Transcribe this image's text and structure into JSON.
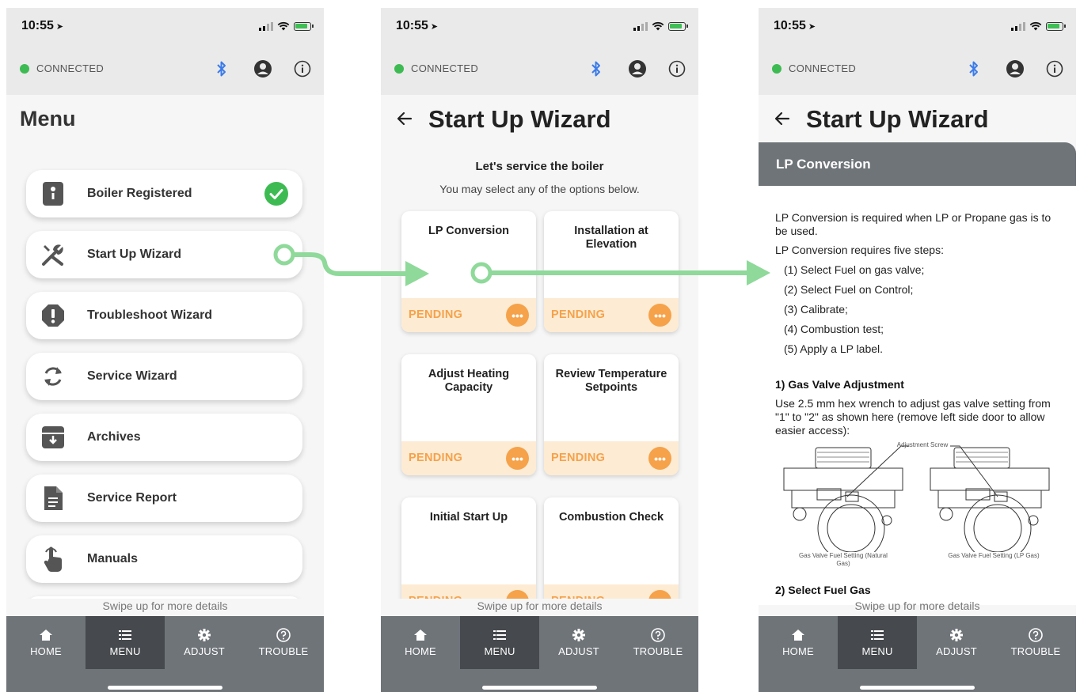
{
  "status_bar": {
    "time": "10:55"
  },
  "header": {
    "connection_label": "CONNECTED"
  },
  "tabs": [
    {
      "label": "HOME",
      "icon": "home-icon"
    },
    {
      "label": "MENU",
      "icon": "menu-list-icon",
      "active": true
    },
    {
      "label": "ADJUST",
      "icon": "gear-icon"
    },
    {
      "label": "TROUBLE",
      "icon": "question-icon"
    }
  ],
  "swipe_hint": "Swipe up for more details",
  "menu_screen": {
    "title": "Menu",
    "items": [
      {
        "label": "Boiler Registered",
        "icon": "boiler-icon",
        "status": "check-icon"
      },
      {
        "label": "Start Up Wizard",
        "icon": "tools-icon"
      },
      {
        "label": "Troubleshoot Wizard",
        "icon": "alert-octagon-icon"
      },
      {
        "label": "Service Wizard",
        "icon": "sync-icon"
      },
      {
        "label": "Archives",
        "icon": "archive-icon"
      },
      {
        "label": "Service Report",
        "icon": "document-icon"
      },
      {
        "label": "Manuals",
        "icon": "touch-hand-icon"
      }
    ]
  },
  "wizard_screen": {
    "title": "Start Up Wizard",
    "subtitle": "Let's service the boiler",
    "instruction": "You may select any of the options below.",
    "cards": [
      {
        "title": "LP Conversion",
        "status": "PENDING"
      },
      {
        "title": "Installation at Elevation",
        "status": "PENDING"
      },
      {
        "title": "Adjust Heating Capacity",
        "status": "PENDING"
      },
      {
        "title": "Review Temperature Setpoints",
        "status": "PENDING"
      },
      {
        "title": "Initial Start Up",
        "status": "PENDING"
      },
      {
        "title": "Combustion Check",
        "status": "PENDING"
      }
    ]
  },
  "lp_screen": {
    "title": "Start Up Wizard",
    "section_title": "LP Conversion",
    "intro": "LP Conversion is required when LP or Propane gas is to be used.",
    "steps_intro": "LP Conversion requires five steps:",
    "steps": [
      "(1) Select Fuel on gas valve;",
      "(2) Select Fuel on Control;",
      "(3) Calibrate;",
      "(4) Combustion test;",
      "(5) Apply a LP label."
    ],
    "step1_heading": "1) Gas Valve Adjustment",
    "step1_text": "Use 2.5 mm hex wrench to adjust gas valve setting from \"1\" to \"2\" as shown here (remove left side door to allow easier access):",
    "figure": {
      "callout": "Adjustment Screw",
      "caption_left": "Gas Valve Fuel Setting (Natural Gas)",
      "caption_right": "Gas Valve Fuel Setting (LP Gas)"
    },
    "step2_heading": "2) Select Fuel Gas"
  },
  "colors": {
    "accent_green": "#3dbb52",
    "arrow_green": "#8fd99a",
    "pending_orange": "#f5a24a",
    "pending_bg": "#fdebd3",
    "tabbar": "#6f7479",
    "tab_active": "#46494d",
    "bluetooth_blue": "#3b7bea"
  }
}
